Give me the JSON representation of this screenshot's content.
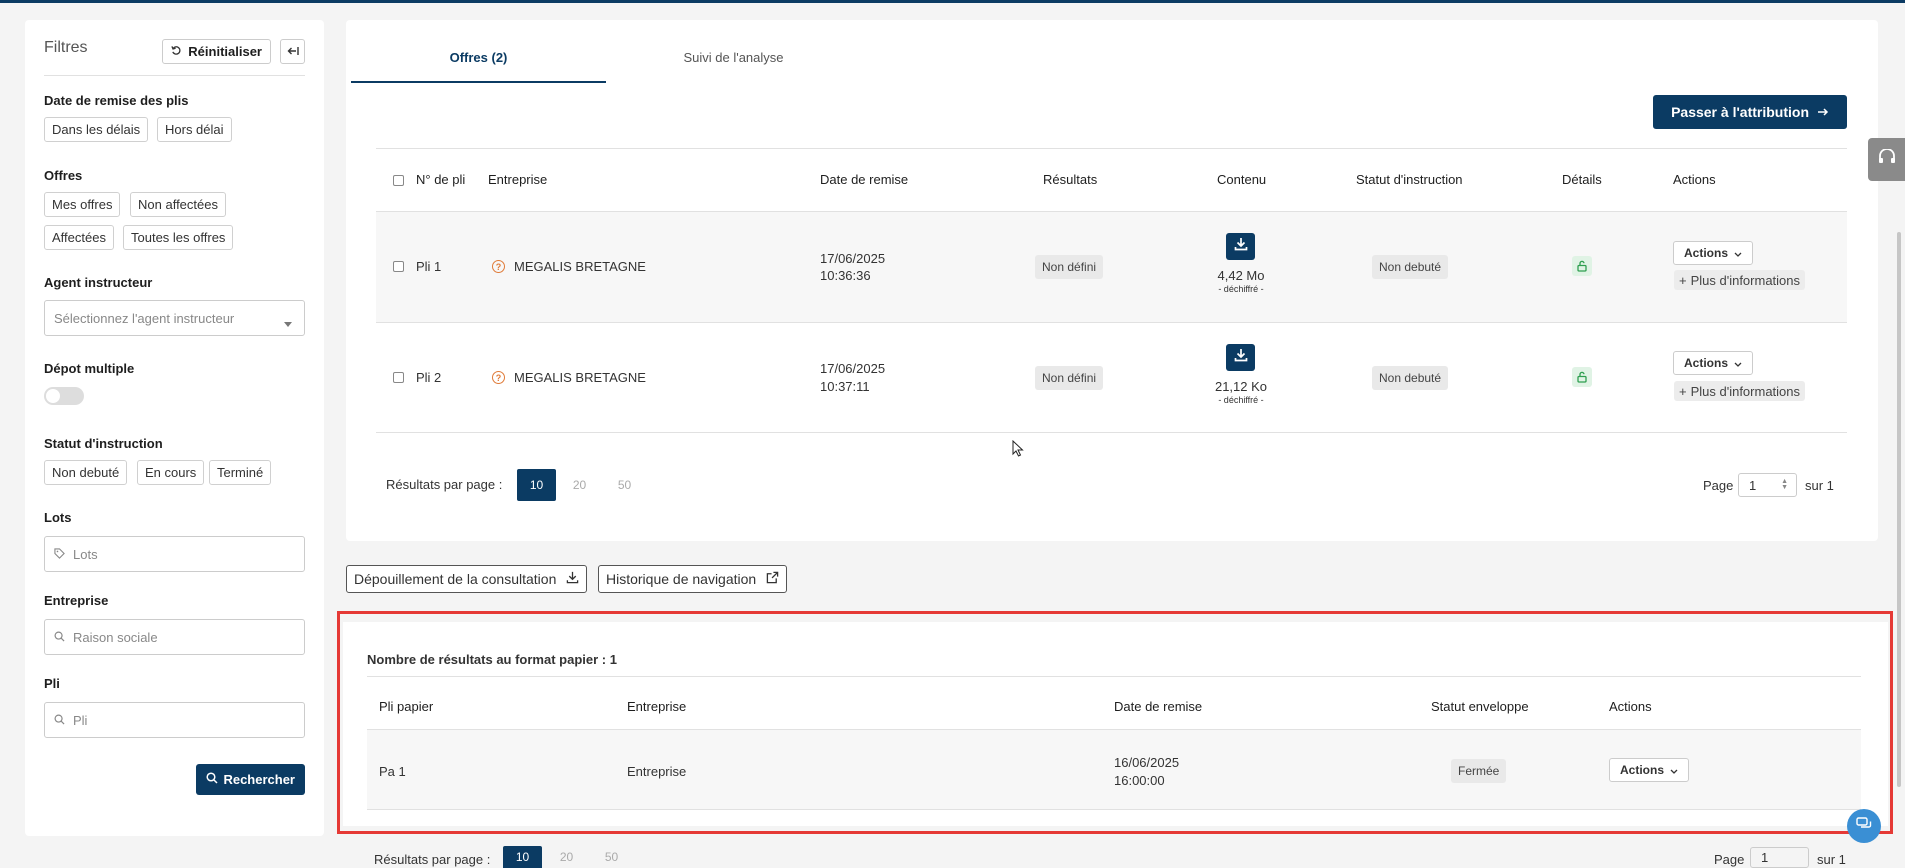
{
  "sidebar": {
    "title": "Filtres",
    "reset_label": "Réinitialiser",
    "date_label": "Date de remise des plis",
    "date_chips": [
      "Dans les délais",
      "Hors délai"
    ],
    "offres_label": "Offres",
    "offres_chips": [
      "Mes offres",
      "Non affectées",
      "Affectées",
      "Toutes les offres"
    ],
    "agent_label": "Agent instructeur",
    "agent_placeholder": "Sélectionnez l'agent instructeur",
    "depot_label": "Dépot multiple",
    "statut_label": "Statut d'instruction",
    "statut_chips": [
      "Non debuté",
      "En cours",
      "Terminé"
    ],
    "lots_label": "Lots",
    "lots_placeholder": "Lots",
    "entreprise_label": "Entreprise",
    "entreprise_placeholder": "Raison sociale",
    "pli_label": "Pli",
    "pli_placeholder": "Pli",
    "search_label": "Rechercher"
  },
  "tabs": [
    "Offres (2)",
    "Suivi de l'analyse"
  ],
  "attribution_label": "Passer à l'attribution",
  "offers_table": {
    "headers": [
      "N° de pli",
      "Entreprise",
      "Date de remise",
      "Résultats",
      "Contenu",
      "Statut d'instruction",
      "Détails",
      "Actions"
    ],
    "rows": [
      {
        "pli": "Pli 1",
        "entreprise": "MEGALIS BRETAGNE",
        "date": "17/06/2025",
        "time": "10:36:36",
        "resultat": "Non défini",
        "size": "4,42 Mo",
        "sub": "- déchiffré -",
        "statut": "Non debuté",
        "actions": "Actions",
        "more": "Plus d'informations"
      },
      {
        "pli": "Pli 2",
        "entreprise": "MEGALIS BRETAGNE",
        "date": "17/06/2025",
        "time": "10:37:11",
        "resultat": "Non défini",
        "size": "21,12 Ko",
        "sub": "- déchiffré -",
        "statut": "Non debuté",
        "actions": "Actions",
        "more": "Plus d'informations"
      }
    ]
  },
  "pager": {
    "label": "Résultats par page :",
    "options": [
      "10",
      "20",
      "50"
    ],
    "page_label": "Page",
    "page_value": "1",
    "of_label": "sur 1"
  },
  "depouillement_label": "Dépouillement de la consultation",
  "historique_label": "Historique de navigation",
  "paper": {
    "title": "Nombre de résultats au format papier : 1",
    "headers": [
      "Pli papier",
      "Entreprise",
      "Date de remise",
      "Statut enveloppe",
      "Actions"
    ],
    "rows": [
      {
        "pli": "Pa 1",
        "entreprise": "Entreprise",
        "date": "16/06/2025",
        "time": "16:00:00",
        "statut": "Fermée",
        "actions": "Actions"
      }
    ]
  },
  "colors": {
    "primary": "#0b3b63",
    "highlight": "#e53935",
    "warning": "#e07b39",
    "success_bg": "#e0f3e5"
  }
}
